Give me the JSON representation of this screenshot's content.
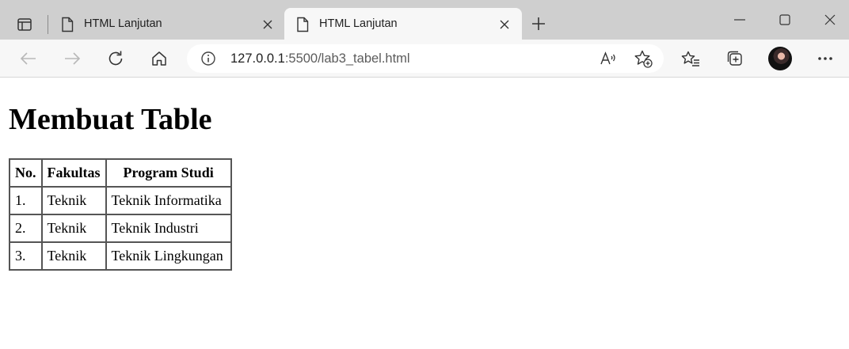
{
  "browser": {
    "tabs": [
      {
        "title": "HTML Lanjutan",
        "active": false
      },
      {
        "title": "HTML Lanjutan",
        "active": true
      }
    ],
    "address": {
      "host": "127.0.0.1",
      "path": ":5500/lab3_tabel.html"
    },
    "icons": {
      "tab_actions": "tab-actions-icon",
      "page": "page-icon",
      "close": "close-icon",
      "new_tab": "plus-icon",
      "minimize": "minimize-icon",
      "maximize": "maximize-icon",
      "window_close": "close-icon",
      "back": "back-arrow-icon",
      "forward": "forward-arrow-icon",
      "refresh": "refresh-icon",
      "home": "home-icon",
      "info": "info-icon",
      "read_aloud": "read-aloud-icon",
      "add_favorite": "star-add-icon",
      "favorites": "favorites-icon",
      "collections": "collections-icon",
      "more": "more-icon"
    }
  },
  "page": {
    "title": "Membuat Table",
    "table": {
      "headers": [
        "No.",
        "Fakultas",
        "Program Studi"
      ],
      "rows": [
        [
          "1.",
          "Teknik",
          "Teknik Informatika"
        ],
        [
          "2.",
          "Teknik",
          "Teknik Industri"
        ],
        [
          "3.",
          "Teknik",
          "Teknik Lingkungan"
        ]
      ]
    }
  }
}
